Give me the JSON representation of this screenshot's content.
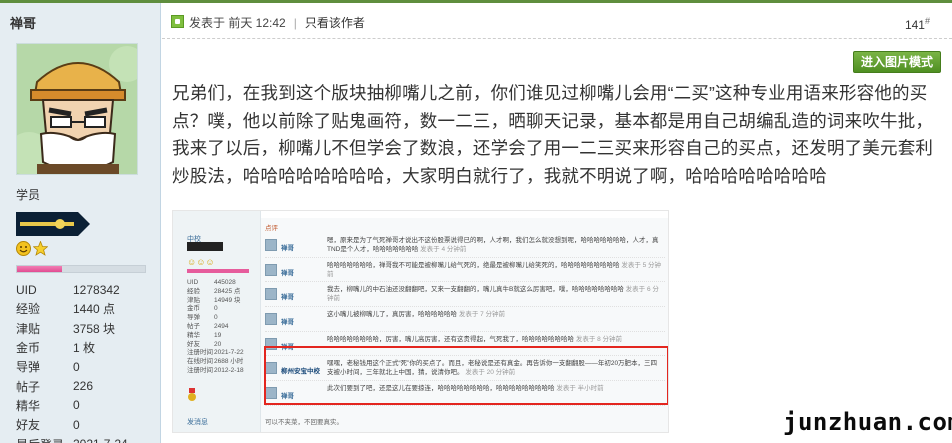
{
  "user": {
    "name": "禅哥",
    "group": "学员",
    "level_progress_percent": 35,
    "stats": [
      {
        "key": "UID",
        "value": "1278342"
      },
      {
        "key": "经验",
        "value": "1440 点"
      },
      {
        "key": "津贴",
        "value": "3758 块"
      },
      {
        "key": "金币",
        "value": "1 枚"
      },
      {
        "key": "导弹",
        "value": "0"
      },
      {
        "key": "帖子",
        "value": "226"
      },
      {
        "key": "精华",
        "value": "0"
      },
      {
        "key": "好友",
        "value": "0"
      },
      {
        "key": "最后登录",
        "value": "2021-7-24"
      }
    ]
  },
  "post": {
    "meta": "发表于 前天 12:42",
    "only_author": "只看该作者",
    "floor": "141",
    "floor_mark": "#",
    "pic_mode_button": "进入图片模式",
    "body": "兄弟们，在我到这个版块抽柳嘴儿之前，你们谁见过柳嘴儿会用“二买”这种专业用语来形容他的买点？噗，他以前除了贴鬼画符，数一二三，晒聊天记录，基本都是用自己胡编乱造的词来吹牛批，我来了以后，柳嘴儿不但学会了数浪，还学会了用一二三买来形容自己的买点，还发明了美元套利炒股法，哈哈哈哈哈哈哈哈，大家明白就行了，我就不明说了啊，哈哈哈哈哈哈哈哈"
  },
  "screenshot": {
    "sidebar_name": "中校",
    "sidebar_stats": [
      {
        "k": "UID",
        "v": "445028"
      },
      {
        "k": "经验",
        "v": "28425 点"
      },
      {
        "k": "津贴",
        "v": "14949 块"
      },
      {
        "k": "金币",
        "v": "0"
      },
      {
        "k": "导弹",
        "v": "0"
      },
      {
        "k": "帖子",
        "v": "2494"
      },
      {
        "k": "精华",
        "v": "19"
      },
      {
        "k": "好友",
        "v": "20"
      },
      {
        "k": "注册时间",
        "v": "2021-7-22"
      },
      {
        "k": "在线时间",
        "v": "2688 小时"
      },
      {
        "k": "注册时间",
        "v": "2012-2-18"
      }
    ],
    "message_link": "发消息",
    "reply_title": "点评",
    "replies": [
      {
        "user": "禅哥",
        "text": "嗯，原来是为了气死禅哥才说出不这份股票说得已的啊，人才啊，我们怎么就没想到呢，哈哈哈哈哈哈哈，人才，真TND是个人才，哈哈哈哈哈哈哈",
        "time": "发表于 4 分钟前"
      },
      {
        "user": "禅哥",
        "text": "哈哈哈哈哈哈哈，禅哥我不可能是被柳嘴儿给气死的，绝最是被柳嘴儿给笑死的，哈哈哈哈哈哈哈哈哈",
        "time": "发表于 5 分钟前"
      },
      {
        "user": "禅哥",
        "text": "我去，柳嘴儿的中石油还没翻翻吧，又来一支翻翻的，嘴儿真牛B就这么厉害吧，噗，哈哈哈哈哈哈哈哈",
        "time": "发表于 6 分钟前"
      },
      {
        "user": "禅哥",
        "text": "这小嘴儿被柳嘴儿了，真厉害，哈哈哈哈哈哈",
        "time": "发表于 7 分钟前"
      },
      {
        "user": "禅哥",
        "text": "哈哈哈哈哈哈哈哈，厉害，嘴儿高厉害，还有这贵得起，气死我了，哈哈哈哈哈哈哈哈",
        "time": "发表于 8 分钟前"
      },
      {
        "user": "柳州安宝中校",
        "text": "嘿嘿，老秘钱用这个正式“死”你的买点了。而且，老秘说是还有真金。再告诉你一支翻翻股——年初20万肥本，三四支被小时间，三年就北上中国，猜，说清你吧。",
        "time": "发表于 20 分钟前"
      },
      {
        "user": "禅哥",
        "text": "此次们要到了吧，还是这儿在要掠连，哈哈哈哈哈哈哈哈，哈哈哈哈哈哈哈哈哈",
        "time": "发表于 半小时前"
      }
    ],
    "footer": "可以不夹菜，不回要真实。"
  },
  "watermark": "junzhuan.com",
  "colors": {
    "accent_green": "#5f8e3e",
    "highlight_red": "#e3261f",
    "sidebar_bg": "#e5edf2",
    "progress_pink": "#e14c92"
  },
  "icons": [
    "online-status-icon",
    "smiley-medal-icon",
    "star-medal-icon",
    "rank-bar-icon"
  ]
}
